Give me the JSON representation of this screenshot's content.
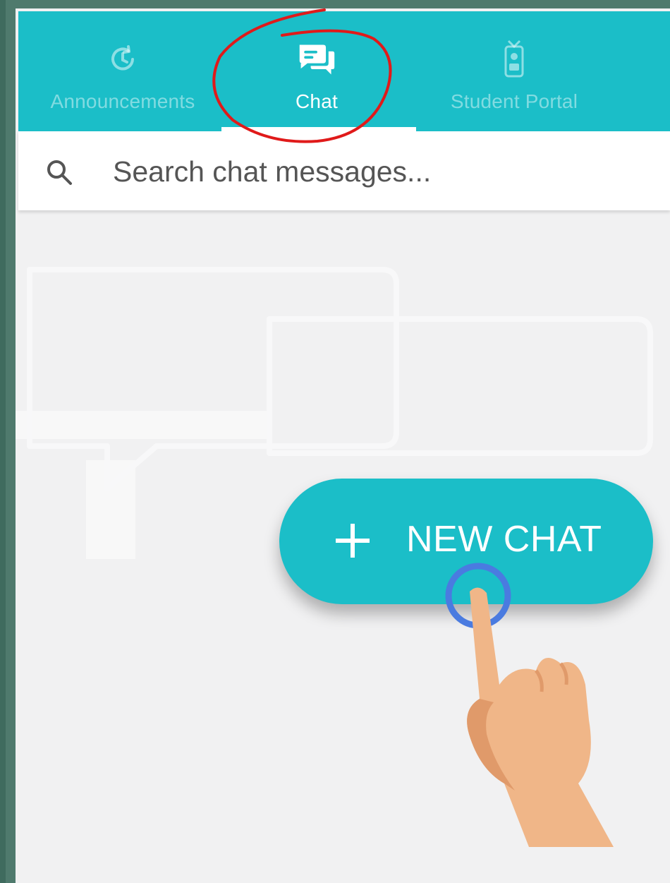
{
  "tabs": [
    {
      "label": "Announcements",
      "icon": "history-icon",
      "active": false
    },
    {
      "label": "Chat",
      "icon": "chat-bubbles-icon",
      "active": true
    },
    {
      "label": "Student Portal",
      "icon": "student-portal-icon",
      "active": false
    }
  ],
  "search": {
    "placeholder": "Search chat messages...",
    "value": "",
    "icon": "search-icon"
  },
  "fab": {
    "label": "NEW CHAT",
    "icon": "plus-icon"
  },
  "colors": {
    "brand": "#1bbec8",
    "background": "#f1f1f2",
    "annotation_circle": "#e01a1a",
    "tap_ring": "#4a7be0",
    "hand": "#f0b688"
  }
}
